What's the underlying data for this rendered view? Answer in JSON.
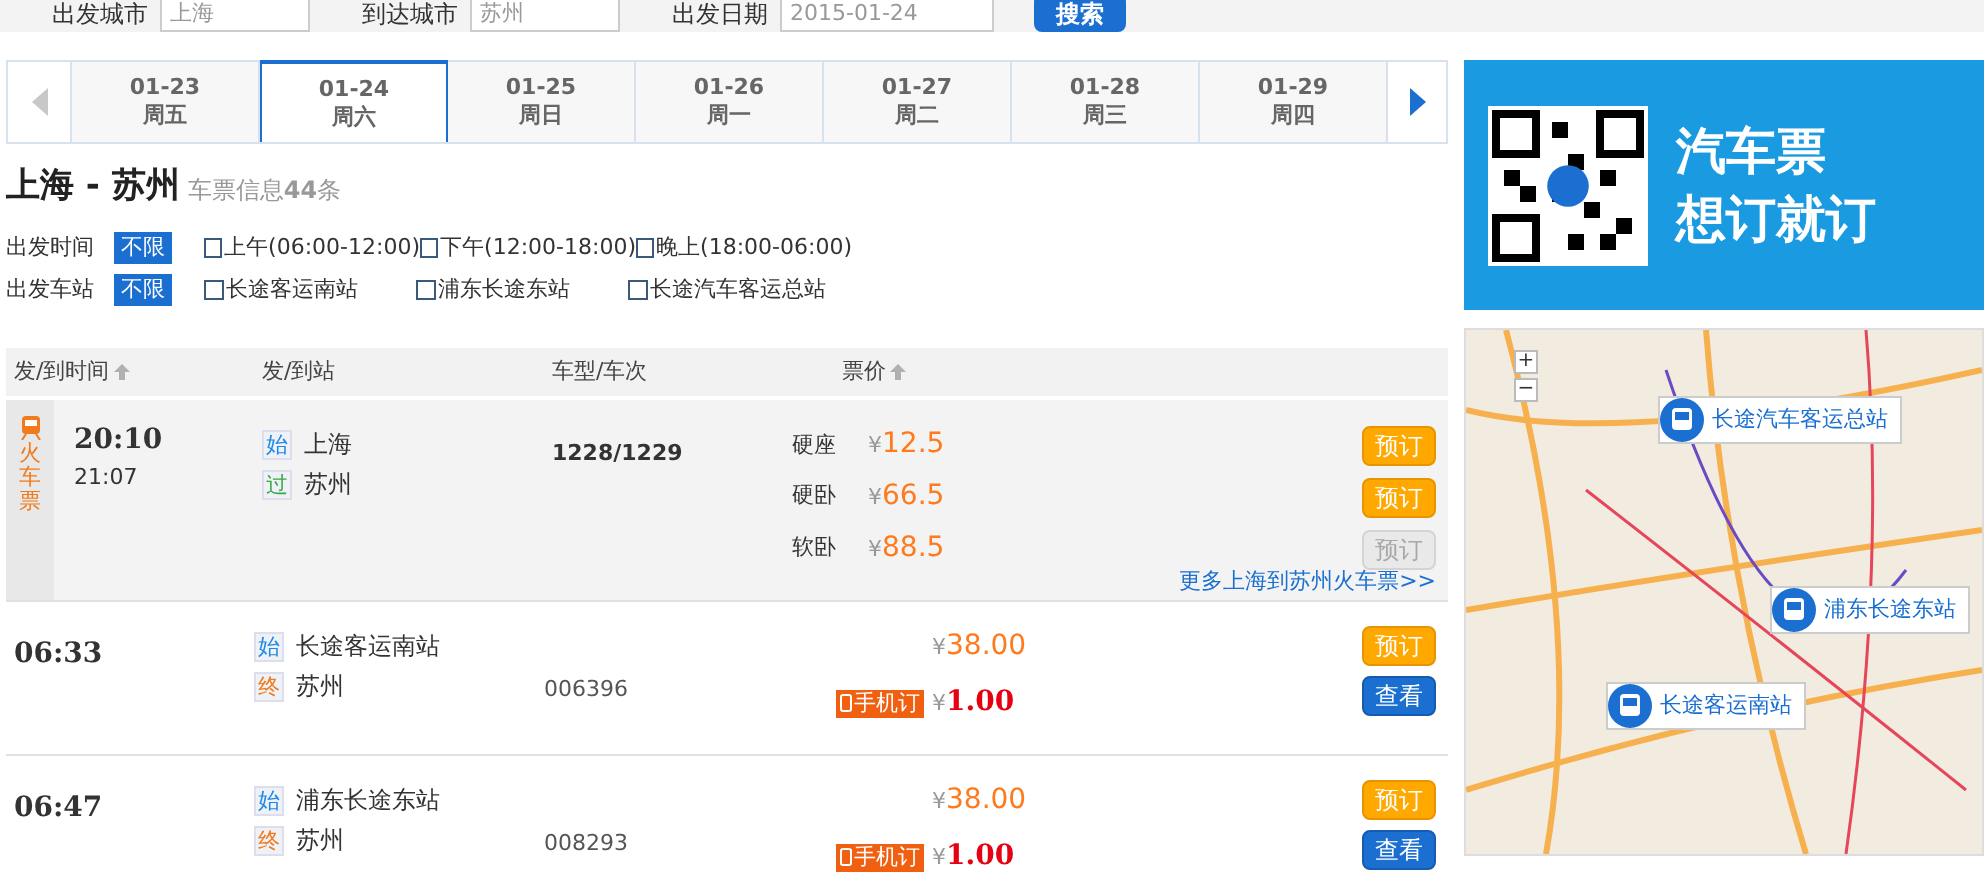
{
  "search": {
    "fields": [
      {
        "label": "出发城市",
        "value": "上海"
      },
      {
        "label": "到达城市",
        "value": "苏州"
      },
      {
        "label": "出发日期",
        "value": "2015-01-24"
      }
    ],
    "button": "搜索"
  },
  "dates": [
    {
      "date": "01-23",
      "weekday": "周五",
      "selected": false
    },
    {
      "date": "01-24",
      "weekday": "周六",
      "selected": true
    },
    {
      "date": "01-25",
      "weekday": "周日",
      "selected": false
    },
    {
      "date": "01-26",
      "weekday": "周一",
      "selected": false
    },
    {
      "date": "01-27",
      "weekday": "周二",
      "selected": false
    },
    {
      "date": "01-28",
      "weekday": "周三",
      "selected": false
    },
    {
      "date": "01-29",
      "weekday": "周四",
      "selected": false
    }
  ],
  "route": {
    "title": "上海 - 苏州",
    "info": "车票信息**44**条"
  },
  "filters": [
    {
      "label": "出发时间",
      "all": {
        "label": "不限",
        "selected": true
      },
      "options": [
        {
          "label": "上午(06:00-12:00)",
          "checked": false
        },
        {
          "label": "下午(12:00-18:00)",
          "checked": false
        },
        {
          "label": "晚上(18:00-06:00)",
          "checked": false
        }
      ]
    },
    {
      "label": "出发车站",
      "all": {
        "label": "不限",
        "selected": true
      },
      "options": [
        {
          "label": "长途客运南站",
          "checked": false
        },
        {
          "label": "浦东长途东站",
          "checked": false
        },
        {
          "label": "长途汽车客运总站",
          "checked": false
        }
      ]
    }
  ],
  "table": {
    "columns": [
      {
        "label": "发/到时间",
        "sortable": true
      },
      {
        "label": "发/到站",
        "sortable": false
      },
      {
        "label": "车型/车次",
        "sortable": false
      },
      {
        "label": "票价",
        "sortable": true
      }
    ],
    "rows": [
      {
        "kind": "train",
        "badge": "火车票",
        "depart": "20:10",
        "arrive": "21:07",
        "stations": [
          {
            "tag": "始",
            "kind": "start",
            "name": "上海"
          },
          {
            "tag": "过",
            "kind": "via",
            "name": "苏州"
          }
        ],
        "number": "1228/1229",
        "prices": [
          {
            "seat": "硬座",
            "currency": "¥",
            "amount": "12.5",
            "button": "预订",
            "disabled": false
          },
          {
            "seat": "硬卧",
            "currency": "¥",
            "amount": "66.5",
            "button": "预订",
            "disabled": false
          },
          {
            "seat": "软卧",
            "currency": "¥",
            "amount": "88.5",
            "button": "预订",
            "disabled": true
          }
        ],
        "more_link": "更多上海到苏州火车票>>"
      },
      {
        "kind": "bus",
        "depart": "06:33",
        "stations": [
          {
            "tag": "始",
            "kind": "start",
            "name": "长途客运南站"
          },
          {
            "tag": "终",
            "kind": "end",
            "name": "苏州"
          }
        ],
        "number": "006396",
        "price": {
          "currency": "¥",
          "amount": "38.00"
        },
        "mobile": {
          "label": "手机订",
          "currency": "¥",
          "amount": "1.00"
        },
        "book_button": "预订",
        "view_button": "查看"
      },
      {
        "kind": "bus",
        "depart": "06:47",
        "stations": [
          {
            "tag": "始",
            "kind": "start",
            "name": "浦东长途东站"
          },
          {
            "tag": "终",
            "kind": "end",
            "name": "苏州"
          }
        ],
        "number": "008293",
        "price": {
          "currency": "¥",
          "amount": "38.00"
        },
        "mobile": {
          "label": "手机订",
          "currency": "¥",
          "amount": "1.00"
        },
        "book_button": "预订",
        "view_button": "查看"
      }
    ]
  },
  "banner": {
    "lines": [
      "汽车票",
      "想订就订"
    ]
  },
  "map": {
    "zoom_in": "+",
    "zoom_out": "−",
    "markers": [
      {
        "name": "长途汽车客运总站"
      },
      {
        "name": "浦东长途东站"
      },
      {
        "name": "长途客运南站"
      }
    ]
  }
}
